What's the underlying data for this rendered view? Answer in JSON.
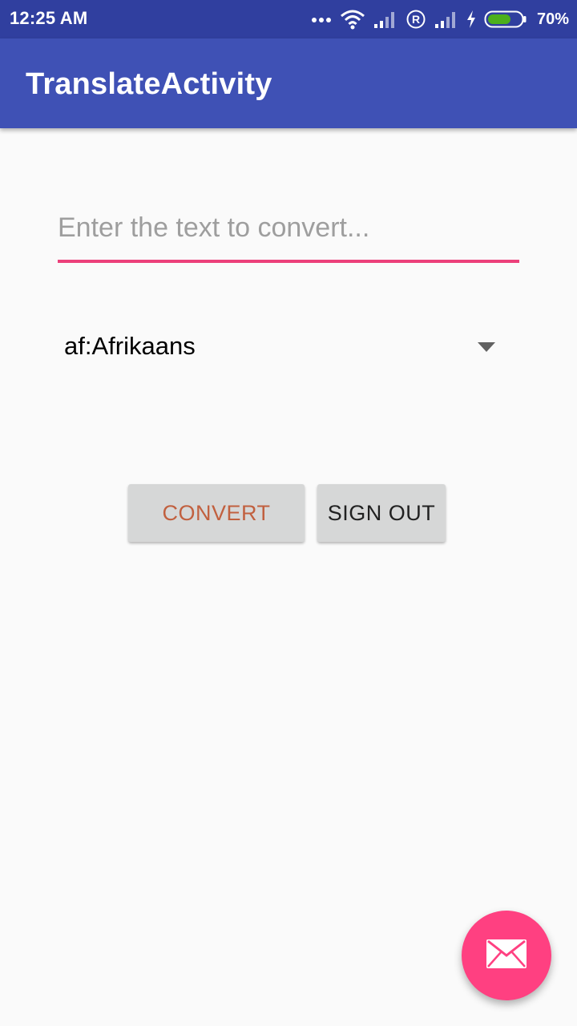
{
  "status_bar": {
    "time": "12:25 AM",
    "battery_percent": "70%",
    "battery_level": 0.7,
    "charging": true,
    "icons": [
      "more-dots-icon",
      "wifi-icon",
      "signal-icon",
      "roaming-r-icon",
      "signal-icon",
      "charging-bolt-icon",
      "battery-icon"
    ]
  },
  "app_bar": {
    "title": "TranslateActivity"
  },
  "text_input": {
    "placeholder": "Enter the text to convert...",
    "value": ""
  },
  "language_spinner": {
    "selected": "af:Afrikaans",
    "icon": "dropdown-arrow-icon"
  },
  "buttons": {
    "convert_label": "CONVERT",
    "sign_out_label": "SIGN OUT"
  },
  "fab": {
    "icon": "email-icon"
  },
  "colors": {
    "status_bar": "#303f9f",
    "app_bar": "#3f51b5",
    "accent": "#ff4081",
    "input_underline": "#ec407a",
    "convert_text": "#c1603f",
    "button_bg": "#d6d7d7",
    "battery_fill": "#4caf1c"
  }
}
